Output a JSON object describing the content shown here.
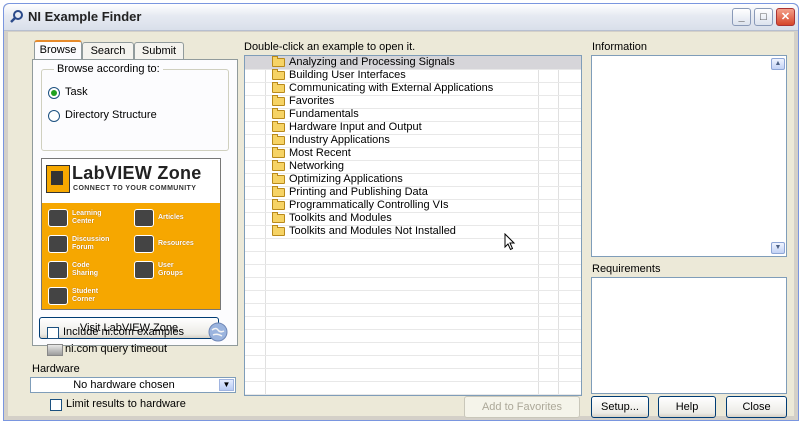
{
  "window": {
    "title": "NI Example Finder",
    "controls": [
      "minimize",
      "maximize",
      "close"
    ]
  },
  "tabs": [
    {
      "label": "Browse",
      "active": true
    },
    {
      "label": "Search",
      "active": false
    },
    {
      "label": "Submit",
      "active": false
    }
  ],
  "browse": {
    "group_label": "Browse according to:",
    "options": [
      {
        "label": "Task",
        "selected": true
      },
      {
        "label": "Directory Structure",
        "selected": false
      }
    ]
  },
  "labview_zone": {
    "name": "LabVIEW Zone",
    "tagline": "CONNECT TO YOUR COMMUNITY",
    "items": [
      {
        "label": "Learning\nCenter",
        "icon": "graduation-cap-icon"
      },
      {
        "label": "Articles",
        "icon": "articles-icon"
      },
      {
        "label": "Discussion\nForum",
        "icon": "discussion-icon"
      },
      {
        "label": "Resources",
        "icon": "resources-icon"
      },
      {
        "label": "Code\nSharing",
        "icon": "code-sharing-icon"
      },
      {
        "label": "User\nGroups",
        "icon": "user-groups-icon"
      },
      {
        "label": "Student\nCorner",
        "icon": "student-icon"
      }
    ],
    "accent": "#f6a700"
  },
  "visit_button": "Visit LabVIEW Zone",
  "include_ni": {
    "label": "Include ni.com examples",
    "checked": false
  },
  "query_timeout": {
    "label": "ni.com query timeout"
  },
  "hardware": {
    "label": "Hardware",
    "value": "No hardware chosen"
  },
  "limit_hw": {
    "label": "Limit results to hardware",
    "checked": false
  },
  "examples": {
    "instruction": "Double-click an example to open it.",
    "items": [
      "Analyzing and Processing Signals",
      "Building User Interfaces",
      "Communicating with External Applications",
      "Favorites",
      "Fundamentals",
      "Hardware Input and Output",
      "Industry Applications",
      "Most Recent",
      "Networking",
      "Optimizing Applications",
      "Printing and Publishing Data",
      "Programmatically Controlling VIs",
      "Toolkits and Modules",
      "Toolkits and Modules Not Installed"
    ],
    "selected_index": 0
  },
  "information": {
    "label": "Information"
  },
  "requirements": {
    "label": "Requirements"
  },
  "buttons": {
    "add_favorites": "Add to Favorites",
    "setup": "Setup...",
    "help": "Help",
    "close": "Close"
  }
}
